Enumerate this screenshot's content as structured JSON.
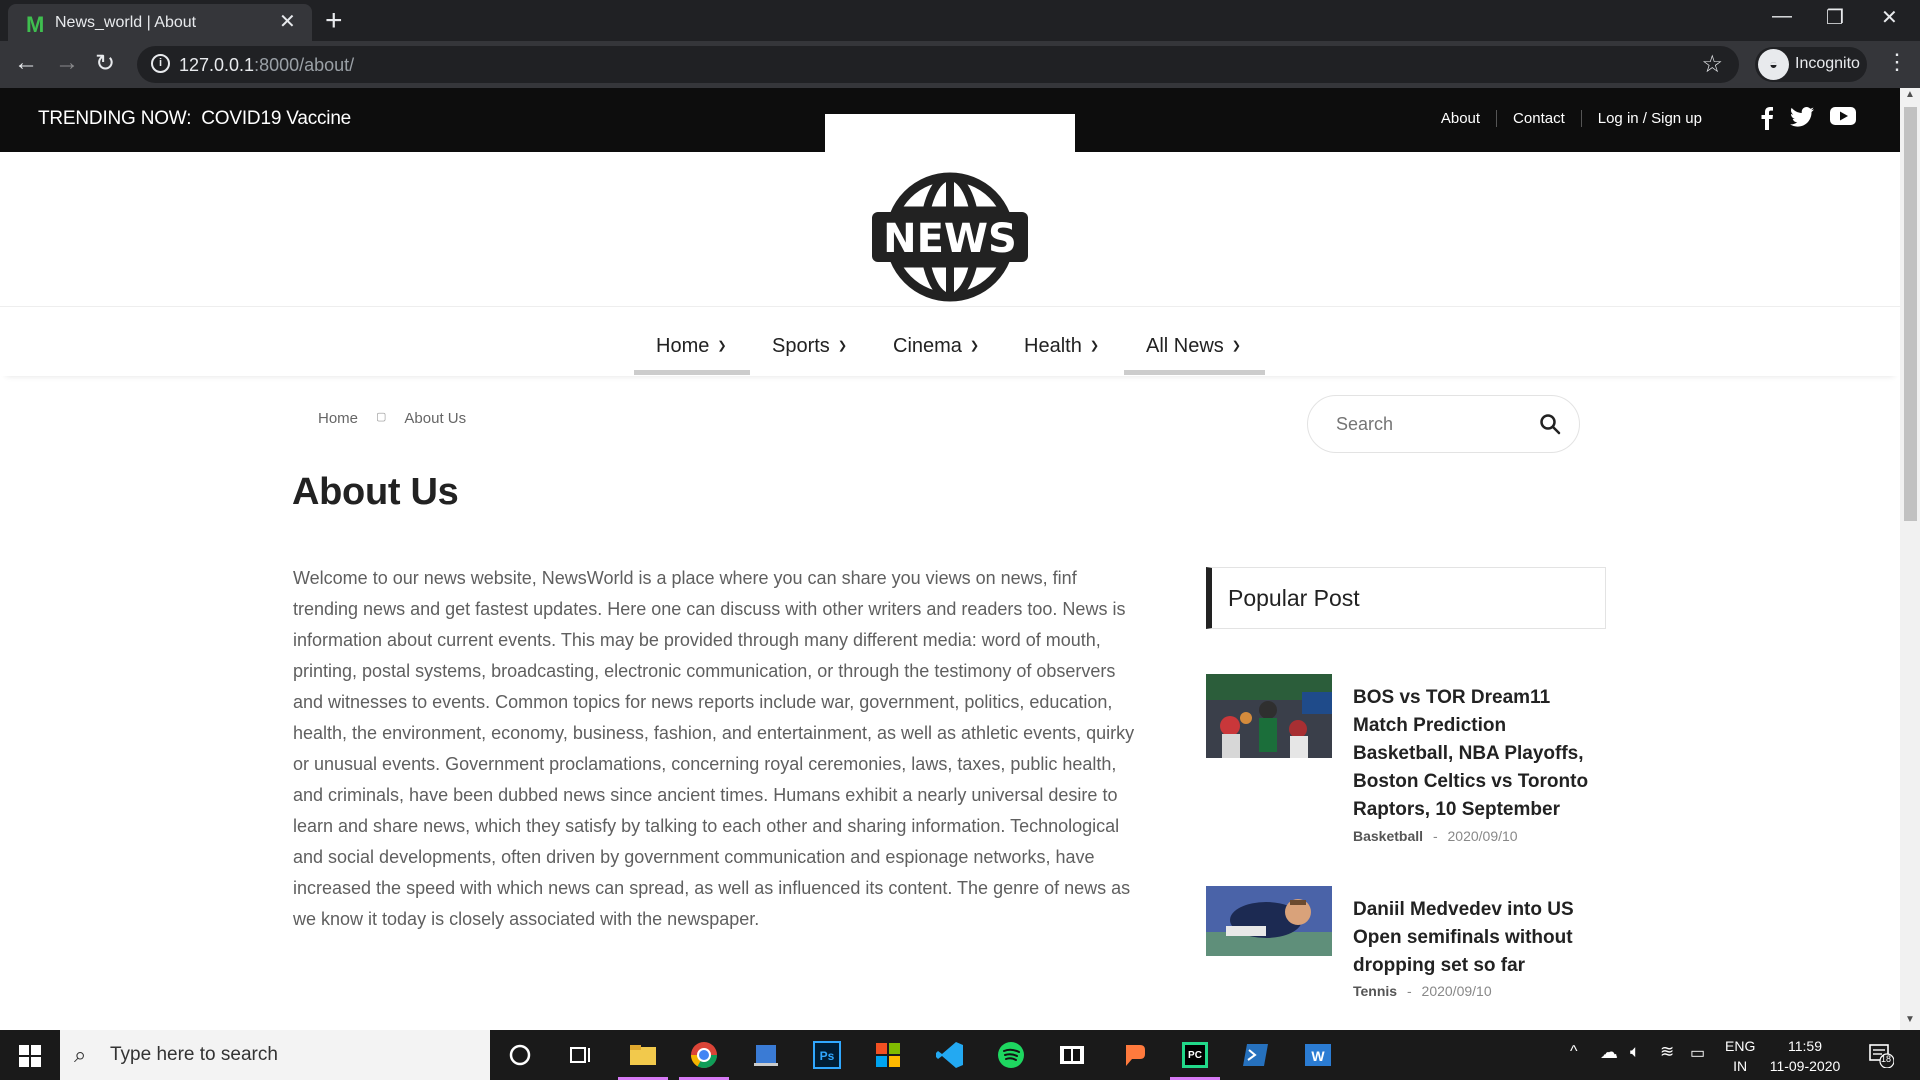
{
  "browser": {
    "tab_title": "News_world | About",
    "tab_favicon": "M",
    "url_host": "127.0.0.1",
    "url_path": ":8000/about/",
    "profile_label": "Incognito"
  },
  "topbar": {
    "trending_label": "TRENDING NOW:",
    "trending_value": "COVID19 Vaccine",
    "links": [
      "About",
      "Contact",
      "Log in / Sign up"
    ],
    "socials": [
      "facebook-icon",
      "twitter-icon",
      "youtube-icon"
    ]
  },
  "logo": {
    "text": "NEWS"
  },
  "nav": {
    "items": [
      "Home",
      "Sports",
      "Cinema",
      "Health",
      "All News"
    ]
  },
  "breadcrumb": {
    "home": "Home",
    "current": "About Us"
  },
  "search": {
    "placeholder": "Search"
  },
  "page": {
    "title": "About Us",
    "body": "Welcome to our news website, NewsWorld is a place where you can share you views on news, finf trending news and get fastest updates. Here one can discuss with other writers and readers too. News is information about current events. This may be provided through many different media: word of mouth, printing, postal systems, broadcasting, electronic communication, or through the testimony of observers and witnesses to events. Common topics for news reports include war, government, politics, education, health, the environment, economy, business, fashion, and entertainment, as well as athletic events, quirky or unusual events. Government proclamations, concerning royal ceremonies, laws, taxes, public health, and criminals, have been dubbed news since ancient times. Humans exhibit a nearly universal desire to learn and share news, which they satisfy by talking to each other and sharing information. Technological and social developments, often driven by government communication and espionage networks, have increased the speed with which news can spread, as well as influenced its content. The genre of news as we know it today is closely associated with the newspaper."
  },
  "popular": {
    "title": "Popular Post",
    "posts": [
      {
        "title": "BOS vs TOR Dream11 Match Prediction Basketball, NBA Playoffs, Boston Celtics vs Toronto Raptors, 10 September",
        "category": "Basketball",
        "separator": "-",
        "date": "2020/09/10"
      },
      {
        "title": "Daniil Medvedev into US Open semifinals without dropping set so far",
        "category": "Tennis",
        "separator": "-",
        "date": "2020/09/10"
      }
    ]
  },
  "taskbar": {
    "search_placeholder": "Type here to search",
    "lang_line1": "ENG",
    "lang_line2": "IN",
    "time": "11:59",
    "date": "11-09-2020",
    "notification_count": "18"
  }
}
